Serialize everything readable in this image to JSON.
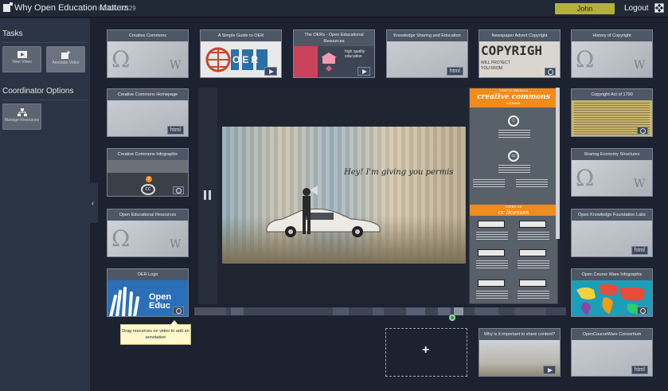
{
  "header": {
    "title": "Why Open Education Matters",
    "time": "01:43 / 02:29",
    "user": "John (Coordinator)",
    "logout": "Logout",
    "expand_icon": "expand-arrows-icon"
  },
  "sidebar": {
    "tasks_heading": "Tasks",
    "tasks": [
      {
        "label": "View Video",
        "icon": "play-icon"
      },
      {
        "label": "Annotate Video",
        "icon": "annotate-icon"
      }
    ],
    "coordinator_heading": "Coordinator Options",
    "coordinator": [
      {
        "label": "Manage Resources",
        "icon": "hierarchy-icon"
      }
    ],
    "collapse_icon": "chevron-left-icon"
  },
  "resources": [
    {
      "title": "Creative Commons",
      "badge": ""
    },
    {
      "title": "A Simple Guide to OER",
      "badge": "video"
    },
    {
      "title": "The OERs - Open Educational Resources",
      "badge": "video"
    },
    {
      "title": "Knowledge Sharing and Education",
      "badge": "html"
    },
    {
      "title": "Newspaper Advert Copyright",
      "badge": "image"
    },
    {
      "title": "History of Copyright",
      "badge": ""
    },
    {
      "title": "Creative Commons Homepage",
      "badge": "html"
    },
    {
      "title": "Copyright Act of 1790",
      "badge": "image"
    },
    {
      "title": "Creative Commons Infographic",
      "badge": "image"
    },
    {
      "title": "Sharing Economy Structures",
      "badge": ""
    },
    {
      "title": "Open Educational Resources",
      "badge": ""
    },
    {
      "title": "Open Knowledge Foundation Labs",
      "badge": "html"
    },
    {
      "title": "OER Logo",
      "badge": "image"
    },
    {
      "title": "Open Course Ware Infographic",
      "badge": "image"
    },
    {
      "title": "Why is it important to share content?",
      "badge": "video"
    },
    {
      "title": "OpenCourseWare Consortium",
      "badge": "html"
    }
  ],
  "thumb_text": {
    "oer_guide": "OER",
    "newspaper": "COPYRIGH",
    "newspaper_sub": "WILL PROTECT YOU FROM",
    "oer_logo": "Open Educ",
    "infographic_cc": "cc",
    "infographic_num": "2",
    "high_quality": "high quality education"
  },
  "badges": {
    "html": "html"
  },
  "video": {
    "caption": "Hey! I'm giving you permis"
  },
  "infographic": {
    "header_small": "HOW TO OBTAIN A",
    "header_big": "creative commons",
    "header_sub": "LICENSE",
    "c_symbol": "C",
    "cc_symbol": "cc",
    "types_small": "TYPES OF",
    "types_big": "cc licenses"
  },
  "tooltip": "Drag resources on video to add an annotation",
  "dropzone_icon": "plus-icon",
  "dropzone_symbol": "+"
}
